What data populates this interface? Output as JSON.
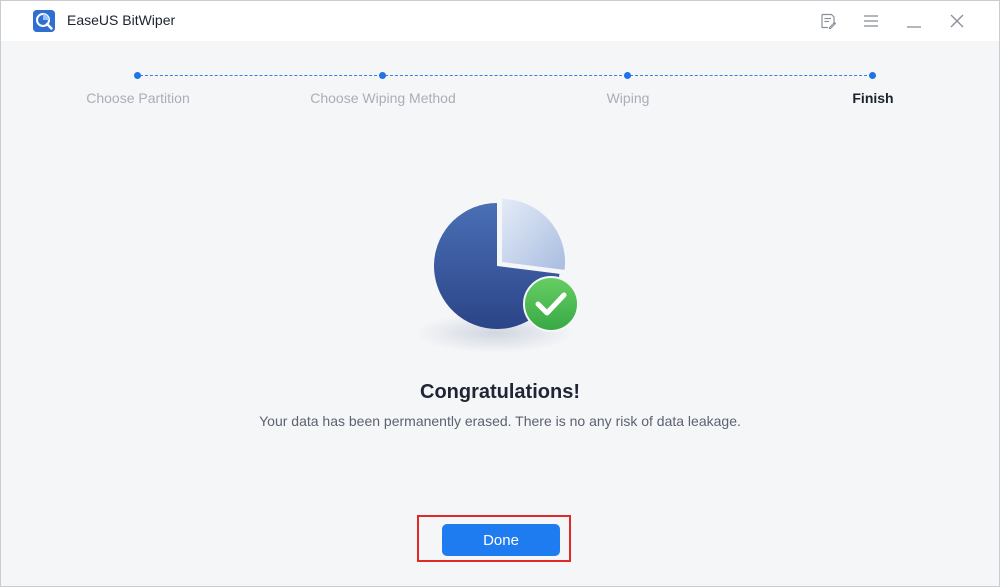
{
  "app": {
    "title": "EaseUS BitWiper",
    "icon": "bitwiper-logo-icon"
  },
  "window_controls": [
    {
      "name": "feedback-icon"
    },
    {
      "name": "menu-icon"
    },
    {
      "name": "minimize-icon"
    },
    {
      "name": "close-icon"
    }
  ],
  "steps": [
    {
      "label": "Choose Partition",
      "state": "done"
    },
    {
      "label": "Choose Wiping Method",
      "state": "done"
    },
    {
      "label": "Wiping",
      "state": "done"
    },
    {
      "label": "Finish",
      "state": "current"
    }
  ],
  "result": {
    "illustration": "pie-chart-check-icon",
    "title": "Congratulations!",
    "message": "Your data has been permanently erased. There is no any risk of data leakage."
  },
  "actions": {
    "done_label": "Done"
  },
  "colors": {
    "accent": "#1f7cf0",
    "success": "#4cbb52",
    "highlight": "#e02a2a"
  }
}
